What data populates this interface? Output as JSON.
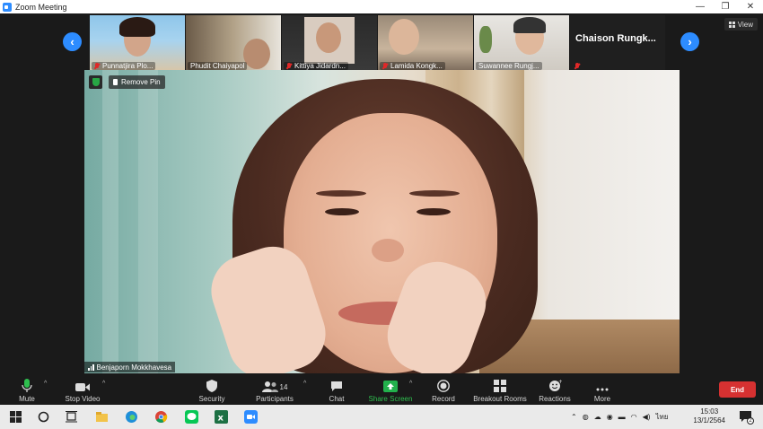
{
  "window": {
    "title": "Zoom Meeting",
    "controls": [
      "—",
      "❐",
      "✕"
    ]
  },
  "view_label": "View",
  "participants_strip": [
    {
      "name": "Punnatjira Plo...",
      "muted": true
    },
    {
      "name": "Phudit Chaiyapol",
      "muted": false
    },
    {
      "name": "Kittiya Jidardn...",
      "muted": true
    },
    {
      "name": "Lamida Kongk...",
      "muted": true
    },
    {
      "name": "Suwannee Rungj...",
      "muted": false
    },
    {
      "name": "Chaison  Rungk...",
      "muted": true
    }
  ],
  "main_video": {
    "speaker_name": "Benjaporn Mokkhavesa",
    "remove_pin_label": "Remove Pin"
  },
  "toolbar": {
    "mute": "Mute",
    "stop_video": "Stop Video",
    "security": "Security",
    "participants": "Participants",
    "participants_count": "14",
    "chat": "Chat",
    "share_screen": "Share Screen",
    "record": "Record",
    "breakout_rooms": "Breakout Rooms",
    "reactions": "Reactions",
    "more": "More",
    "end": "End"
  },
  "taskbar": {
    "lang": "ไทย",
    "time": "15:03",
    "date": "13/1/2564",
    "notifications": "2"
  },
  "colors": {
    "accent": "#2d8cff",
    "end": "#d63131",
    "share": "#22b14c"
  }
}
